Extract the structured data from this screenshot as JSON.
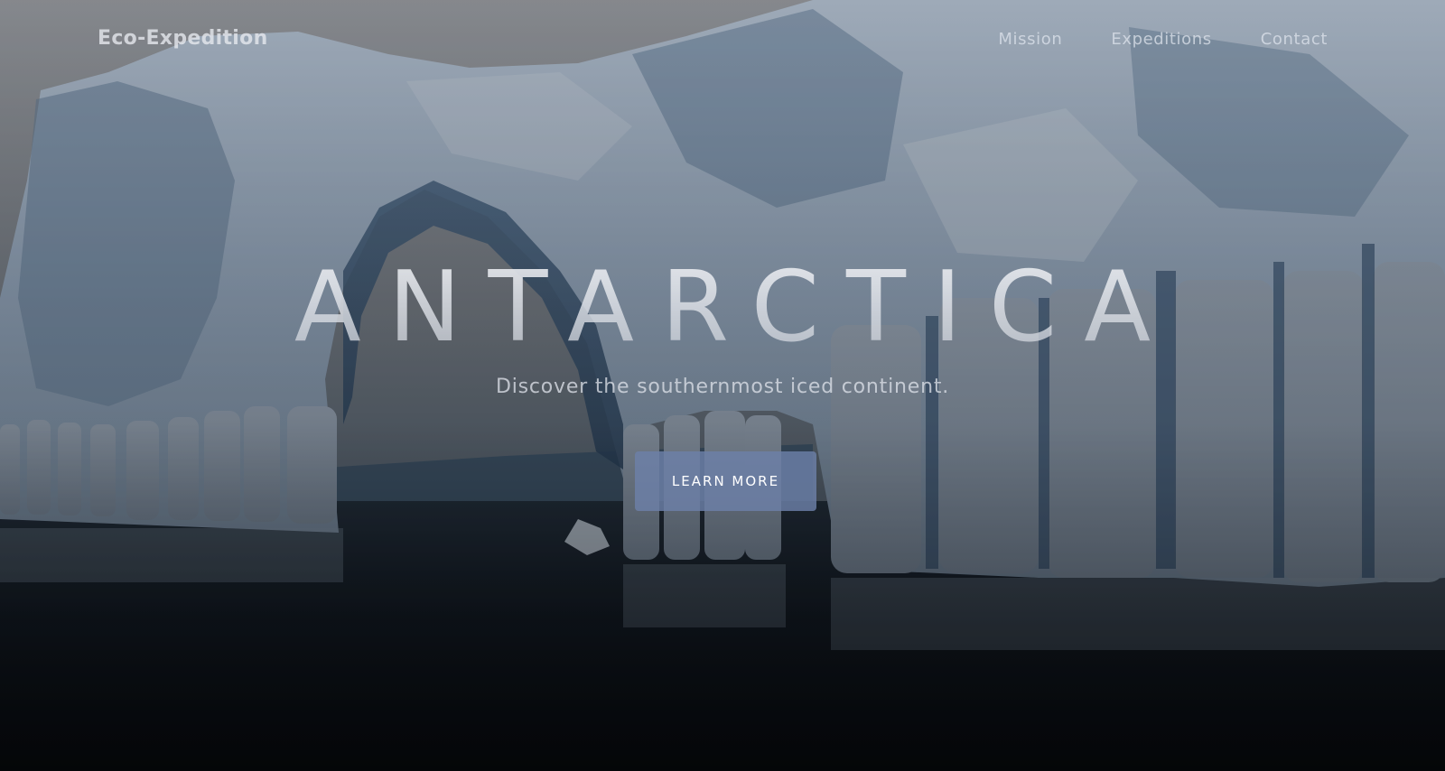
{
  "brand": {
    "name": "Eco-Expedition"
  },
  "nav": {
    "links": [
      {
        "label": "Mission"
      },
      {
        "label": "Expeditions"
      },
      {
        "label": "Contact"
      }
    ]
  },
  "hero": {
    "title": "ANTARCTICA",
    "subtitle": "Discover the southernmost iced continent.",
    "cta_label": "LEARN MORE",
    "background": "iceberg-photo"
  },
  "colors": {
    "cta": "#6c80a8",
    "overlay": "#0b0f16",
    "ice": "#c8d6e6"
  }
}
